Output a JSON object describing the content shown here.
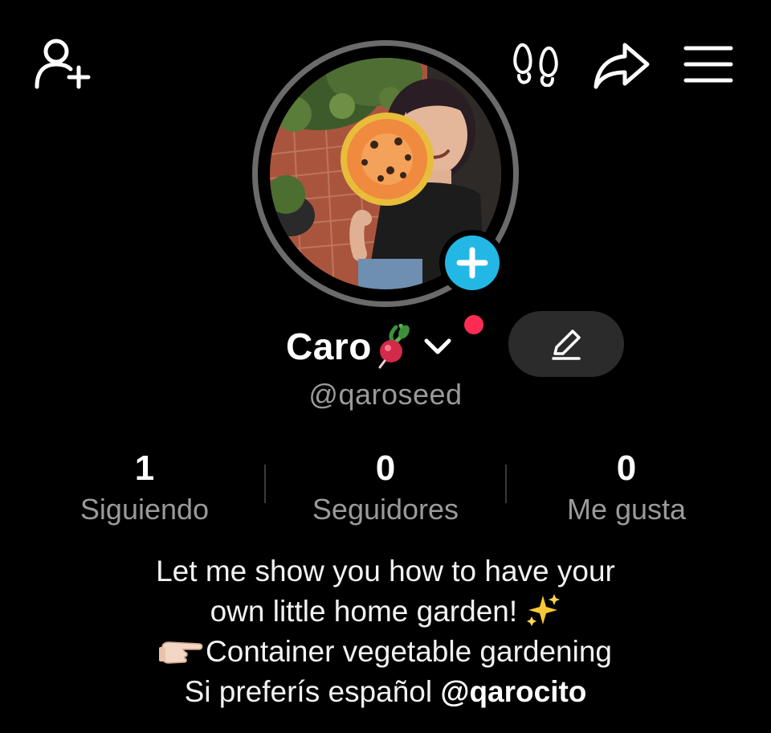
{
  "profile": {
    "display_name": "Caro",
    "handle": "@qaroseed",
    "name_emoji": "radish-icon"
  },
  "stats": {
    "following": {
      "value": "1",
      "label": "Siguiendo"
    },
    "followers": {
      "value": "0",
      "label": "Seguidores"
    },
    "likes": {
      "value": "0",
      "label": "Me gusta"
    }
  },
  "bio": {
    "line1": "Let me show you how to have your",
    "line2": "own little home garden!",
    "line3": "Container vegetable gardening",
    "line4_text": "Si preferís español",
    "line4_mention": "@qarocito",
    "line2_emoji": "sparkles-icon",
    "line3_emoji": "pointing-right-icon"
  },
  "colors": {
    "background": "#000000",
    "accent_add": "#23b7e5",
    "notification": "#fe2c55",
    "secondary_text": "#9a9a9a",
    "edit_button_bg": "#2b2b2b"
  },
  "icons": {
    "top_left": "add-friend-icon",
    "top_right": [
      "footprints-icon",
      "share-icon",
      "menu-icon"
    ]
  }
}
